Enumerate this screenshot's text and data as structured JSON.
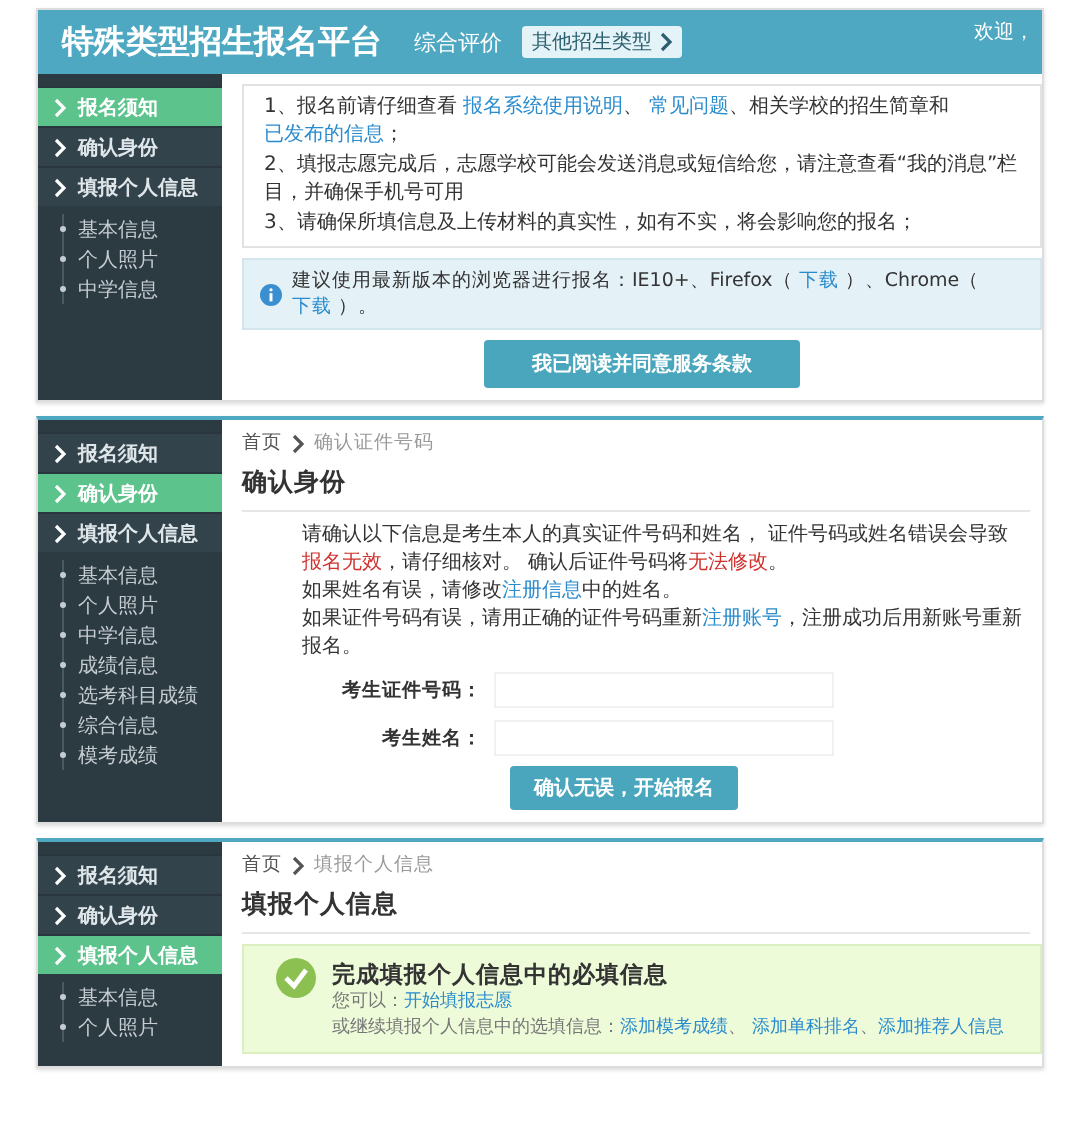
{
  "panels": [
    {
      "kind": "notice",
      "header": {
        "title": "特殊类型招生报名平台",
        "subtitle": "综合评价",
        "type_button": "其他招生类型",
        "welcome": "欢迎，"
      },
      "sidebar": [
        {
          "label": "报名须知",
          "selected": true
        },
        {
          "label": "确认身份",
          "selected": false
        },
        {
          "label": "填报个人信息",
          "selected": false
        }
      ],
      "sub_items": [
        "基本信息",
        "个人照片",
        "中学信息"
      ],
      "notices": [
        [
          {
            "kind": "text",
            "text": "1、报名前请仔细查看 "
          },
          {
            "kind": "link",
            "text": "报名系统使用说明"
          },
          {
            "kind": "text",
            "text": "、 "
          },
          {
            "kind": "link",
            "text": "常见问题"
          },
          {
            "kind": "text",
            "text": "、相关学校的招生简章和 "
          },
          {
            "kind": "link",
            "text": "已发布的信息"
          },
          {
            "kind": "text",
            "text": "；"
          }
        ],
        [
          {
            "kind": "text",
            "text": "2、填报志愿完成后，志愿学校可能会发送消息或短信给您，请注意查看“我的消息”栏目，并确保手机号可用"
          }
        ],
        [
          {
            "kind": "text",
            "text": "3、请确保所填信息及上传材料的真实性，如有不实，将会影响您的报名；"
          }
        ]
      ],
      "tip": [
        {
          "kind": "text",
          "text": "建议使用最新版本的浏览器进行报名：IE10+、Firefox（ "
        },
        {
          "kind": "link",
          "text": "下载"
        },
        {
          "kind": "text",
          "text": " ）、Chrome（ "
        },
        {
          "kind": "link",
          "text": "下载"
        },
        {
          "kind": "text",
          "text": " ）。"
        }
      ],
      "button": "我已阅读并同意服务条款"
    },
    {
      "kind": "identity",
      "sidebar": [
        {
          "label": "报名须知",
          "selected": false
        },
        {
          "label": "确认身份",
          "selected": true
        },
        {
          "label": "填报个人信息",
          "selected": false
        }
      ],
      "sub_items": [
        "基本信息",
        "个人照片",
        "中学信息",
        "成绩信息",
        "选考科目成绩",
        "综合信息",
        "模考成绩"
      ],
      "breadcrumb": [
        "首页",
        "确认证件号码"
      ],
      "heading": "确认身份",
      "paragraphs": [
        [
          {
            "kind": "text",
            "text": "请确认以下信息是考生本人的真实证件号码和姓名， 证件号码或姓名错误会导致"
          },
          {
            "kind": "warn",
            "text": "报名无效"
          },
          {
            "kind": "text",
            "text": "，请仔细核对。 确认后证件号码将"
          },
          {
            "kind": "warn",
            "text": "无法修改"
          },
          {
            "kind": "text",
            "text": "。"
          }
        ],
        [
          {
            "kind": "text",
            "text": "如果姓名有误，请修改"
          },
          {
            "kind": "link",
            "text": "注册信息"
          },
          {
            "kind": "text",
            "text": "中的姓名。"
          }
        ],
        [
          {
            "kind": "text",
            "text": "如果证件号码有误，请用正确的证件号码重新"
          },
          {
            "kind": "link",
            "text": "注册账号"
          },
          {
            "kind": "text",
            "text": "，注册成功后用新账号重新报名。"
          }
        ]
      ],
      "fields": [
        {
          "label": "考生证件号码："
        },
        {
          "label": "考生姓名："
        }
      ],
      "button": "确认无误，开始报名"
    },
    {
      "kind": "personal",
      "sidebar": [
        {
          "label": "报名须知",
          "selected": false
        },
        {
          "label": "确认身份",
          "selected": false
        },
        {
          "label": "填报个人信息",
          "selected": true
        }
      ],
      "sub_items": [
        "基本信息",
        "个人照片"
      ],
      "breadcrumb": [
        "首页",
        "填报个人信息"
      ],
      "heading": "填报个人信息",
      "success": {
        "title": "完成填报个人信息中的必填信息",
        "lines": [
          [
            {
              "kind": "text",
              "text": "您可以："
            },
            {
              "kind": "link",
              "text": "开始填报志愿"
            }
          ],
          [
            {
              "kind": "text",
              "text": "或继续填报个人信息中的选填信息："
            },
            {
              "kind": "link",
              "text": "添加模考成绩"
            },
            {
              "kind": "text",
              "text": "、 "
            },
            {
              "kind": "link",
              "text": "添加单科排名"
            },
            {
              "kind": "text",
              "text": "、"
            },
            {
              "kind": "link",
              "text": "添加推荐人信息"
            }
          ]
        ]
      }
    }
  ]
}
